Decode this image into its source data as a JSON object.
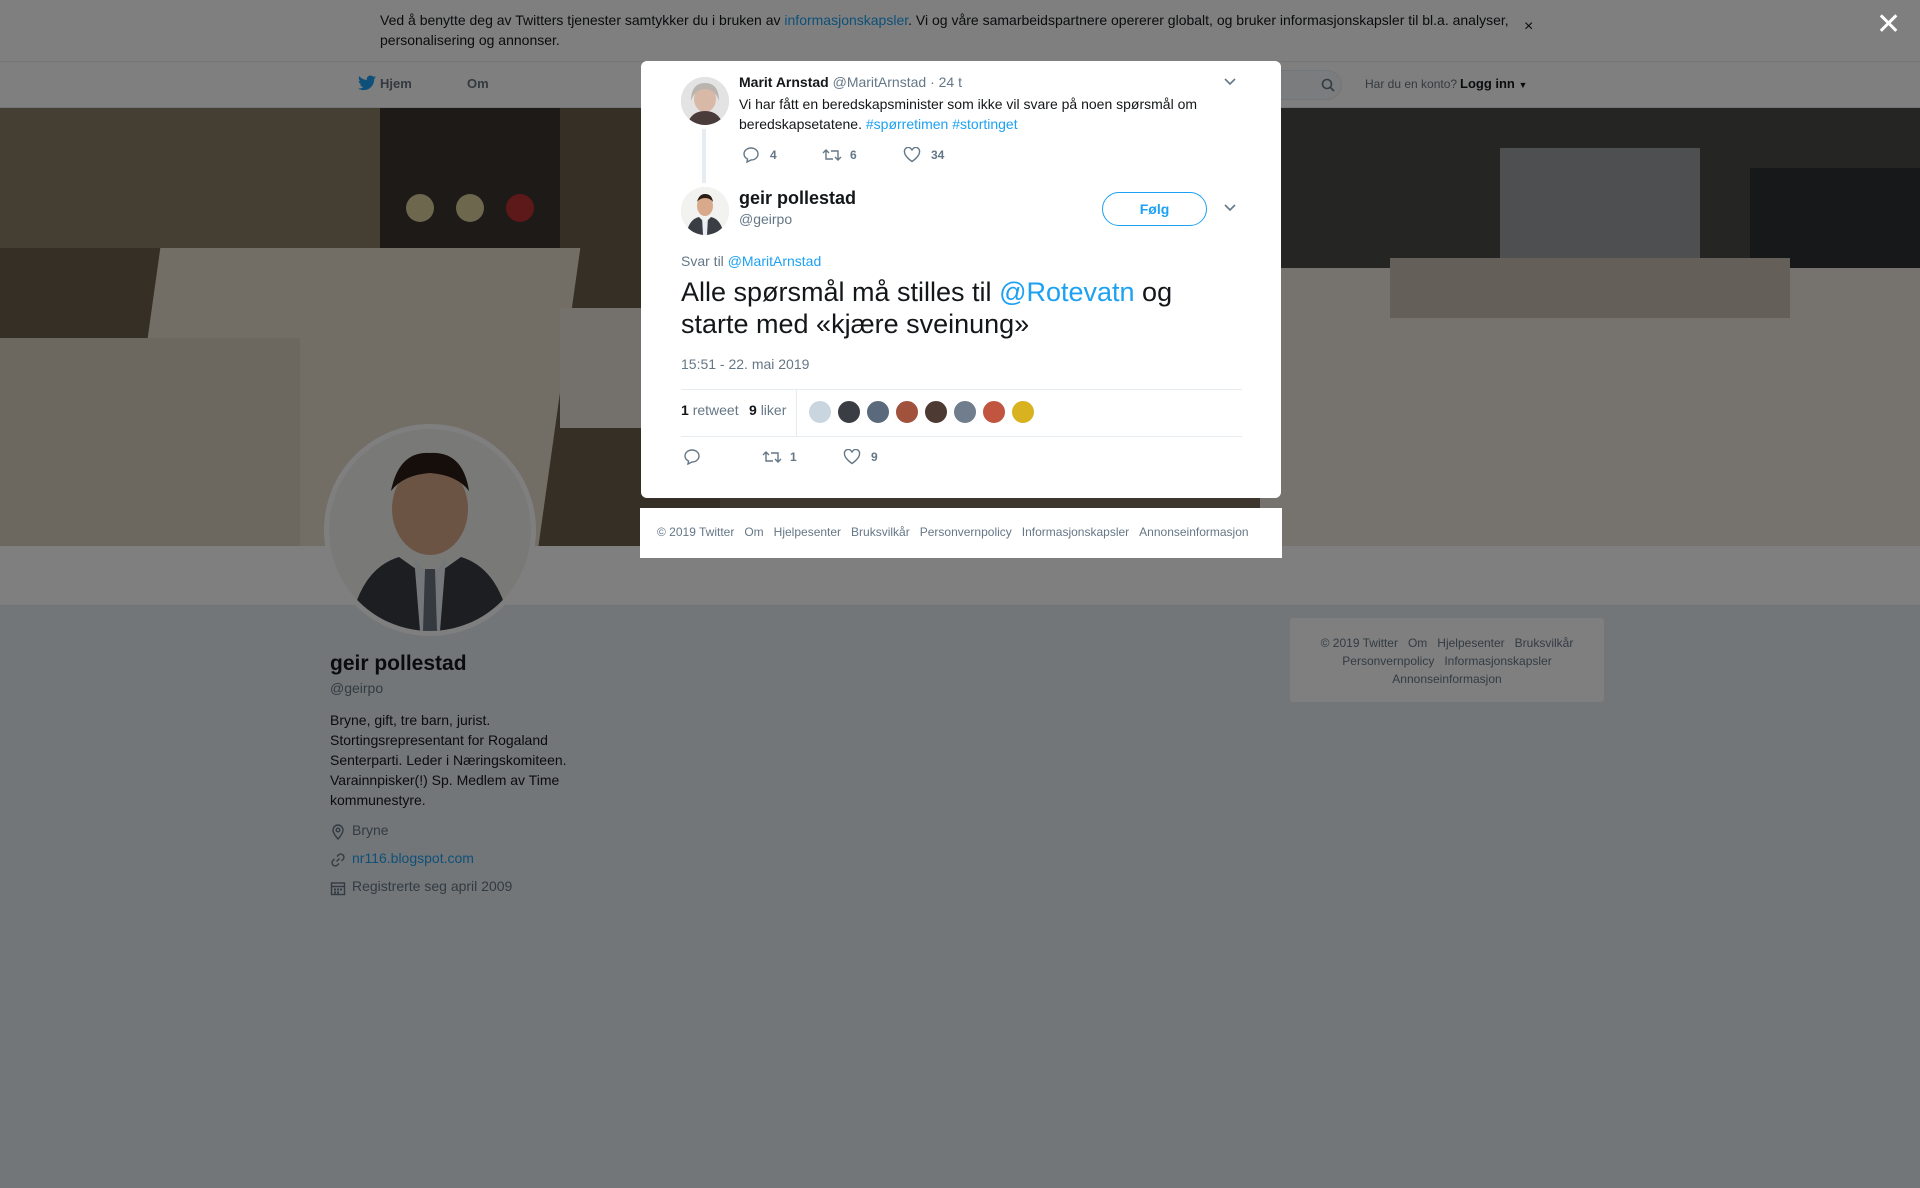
{
  "cookie_banner": {
    "text_before": "Ved å benytte deg av Twitters tjenester samtykker du i bruken av ",
    "link": "informasjonskapsler",
    "text_after": ". Vi og våre samarbeidspartnere opererer globalt, og bruker informasjonskapsler til bl.a. analyser, personalisering og annonser.",
    "close": "×"
  },
  "nav": {
    "home": "Hjem",
    "about": "Om",
    "login_question": "Har du en konto?",
    "login": "Logg inn"
  },
  "profile": {
    "name": "geir pollestad",
    "handle": "@geirpo",
    "bio": "Bryne, gift, tre barn, jurist. Stortingsrepresentant for Rogaland Senterparti. Leder i Næringskomiteen. Varainnpisker(!) Sp. Medlem av Time kommunestyre.",
    "location": "Bryne",
    "url": "nr116.blogspot.com",
    "joined": "Registrerte seg april 2009"
  },
  "side_footer": {
    "items": [
      "© 2019 Twitter",
      "Om",
      "Hjelpesenter",
      "Bruksvilkår",
      "Personvernpolicy",
      "Informasjonskapsler",
      "Annonseinformasjon"
    ]
  },
  "modal": {
    "close": "✕",
    "parent_tweet": {
      "name": "Marit Arnstad",
      "handle": "@MaritArnstad",
      "time": "· 24 t",
      "text": "Vi har fått en beredskapsminister som ikke vil svare på noen spørsmål om beredskapsetatene.",
      "hashtag1": "#spørretimen",
      "hashtag2": "#stortinget",
      "replies": "4",
      "retweets": "6",
      "likes": "34"
    },
    "tweet": {
      "name": "geir pollestad",
      "handle": "@geirpo",
      "follow": "Følg",
      "reply_prefix": "Svar til",
      "reply_to": "@MaritArnstad",
      "text_1": "Alle spørsmål må stilles til ",
      "mention": "@Rotevatn",
      "text_2": "  og starte med «kjære sveinung»",
      "timestamp": "15:51 - 22. mai 2019",
      "retweet_count": "1",
      "retweet_label": "retweet",
      "like_count": "9",
      "like_label": "liker",
      "action_retweets": "1",
      "action_likes": "9"
    },
    "footer": {
      "items": [
        "© 2019 Twitter",
        "Om",
        "Hjelpesenter",
        "Bruksvilkår",
        "Personvernpolicy",
        "Informasjonskapsler",
        "Annonseinformasjon"
      ]
    }
  },
  "colors": {
    "accent": "#1da1f2",
    "overlay": "rgba(0,0,0,0.5)"
  }
}
